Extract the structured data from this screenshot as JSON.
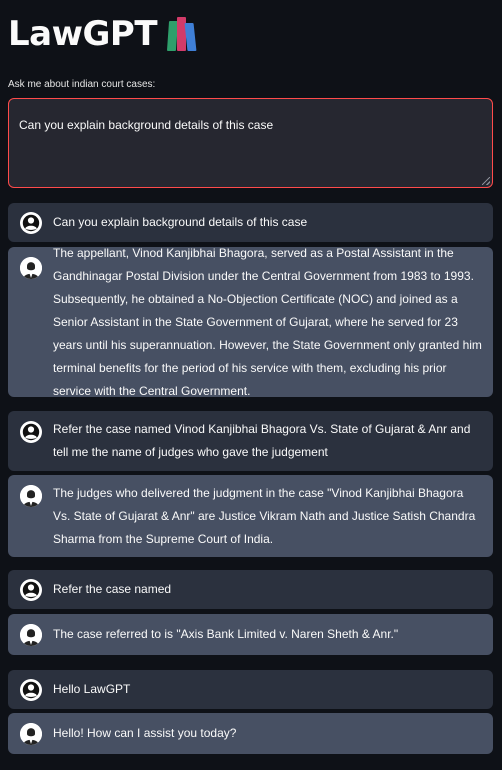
{
  "app": {
    "title": "LawGPT",
    "title_icon": "books-icon"
  },
  "input": {
    "label": "Ask me about indian court cases:",
    "value": "Can you explain background details of this case"
  },
  "messages": [
    {
      "role": "user",
      "text": "Can you explain background details of this case"
    },
    {
      "role": "bot",
      "text": "The appellant, Vinod Kanjibhai Bhagora, served as a Postal Assistant in the Gandhinagar Postal Division under the Central Government from 1983 to 1993. Subsequently, he obtained a No-Objection Certificate (NOC) and joined as a Senior Assistant in the State Government of Gujarat, where he served for 23 years until his superannuation. However, the State Government only granted him terminal benefits for the period of his service with them, excluding his prior service with the Central Government."
    },
    {
      "role": "user",
      "text": "Refer the case named Vinod Kanjibhai Bhagora Vs. State of Gujarat & Anr and tell me the name of judges who gave the judgement"
    },
    {
      "role": "bot",
      "text": "The judges who delivered the judgment in the case \"Vinod Kanjibhai Bhagora Vs. State of Gujarat & Anr\" are Justice Vikram Nath and Justice Satish Chandra Sharma from the Supreme Court of India."
    },
    {
      "role": "user",
      "text": "Refer the case named"
    },
    {
      "role": "bot",
      "text": "The case referred to is \"Axis Bank Limited v. Naren Sheth & Anr.\""
    },
    {
      "role": "user",
      "text": "Hello LawGPT"
    },
    {
      "role": "bot",
      "text": "Hello! How can I assist you today?"
    }
  ],
  "colors": {
    "background": "#0e1117",
    "user_bubble": "#2b313e",
    "bot_bubble": "#475063",
    "input_border": "#ff4b4b"
  }
}
